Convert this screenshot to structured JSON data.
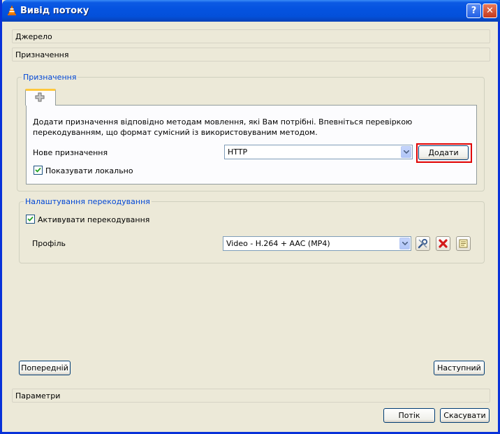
{
  "window": {
    "title": "Вивід потоку"
  },
  "sections": {
    "source": "Джерело",
    "destination": "Призначення",
    "options": "Параметри"
  },
  "destination_group": {
    "legend": "Призначення",
    "description": "Додати призначення відповідно методам мовлення, які Вам потрібні. Впевніться перевіркою перекодуванням, що формат сумісний із використовуваним методом.",
    "new_destination_label": "Нове призначення",
    "new_destination_value": "HTTP",
    "add_button": "Додати",
    "show_locally_label": "Показувати локально",
    "show_locally_checked": true
  },
  "transcode_group": {
    "legend": "Налаштування перекодування",
    "activate_label": "Активувати перекодування",
    "activate_checked": true,
    "profile_label": "Профіль",
    "profile_value": "Video - H.264 + AAC (MP4)",
    "profile_icons": [
      "wrench-icon",
      "delete-icon",
      "new-profile-icon"
    ]
  },
  "nav": {
    "prev_button": "Попередній",
    "next_button": "Наступний"
  },
  "footer": {
    "stream_button": "Потік",
    "cancel_button": "Скасувати"
  },
  "colors": {
    "accent": "#0046d5",
    "highlight": "#e00000",
    "titlebar": "#0553e0"
  }
}
